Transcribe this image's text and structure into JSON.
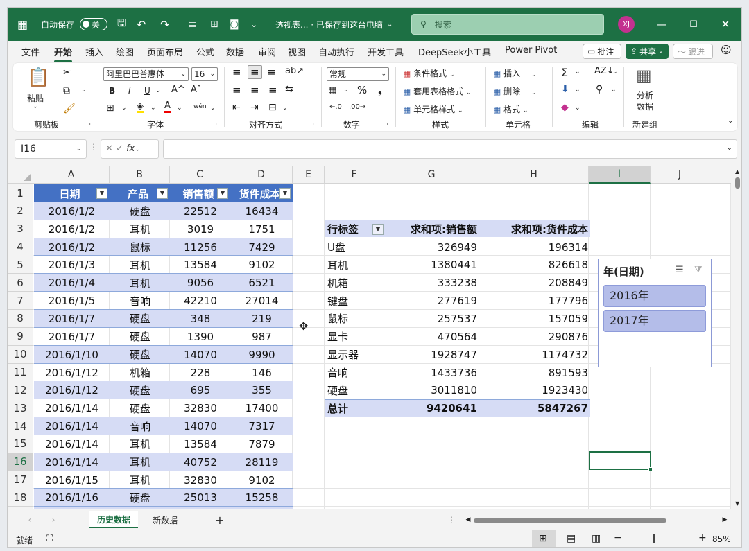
{
  "titlebar": {
    "autosave_label": "自动保存",
    "autosave_state": "关",
    "doc_title": "透视表... · 已保存到这台电脑",
    "search_placeholder": "搜索",
    "avatar": "XJ"
  },
  "menu_tabs": [
    "文件",
    "开始",
    "插入",
    "绘图",
    "页面布局",
    "公式",
    "数据",
    "审阅",
    "视图",
    "自动执行",
    "开发工具",
    "DeepSeek小工具",
    "Power Pivot"
  ],
  "menu_buttons": {
    "comment": "批注",
    "share": "共享",
    "catch_up": "跟进"
  },
  "ribbon": {
    "clipboard": {
      "paste": "粘贴",
      "group": "剪贴板"
    },
    "font": {
      "name": "阿里巴巴普惠体",
      "size": "16",
      "group": "字体",
      "bold": "B",
      "italic": "I",
      "underline": "U"
    },
    "alignment": {
      "group": "对齐方式"
    },
    "number": {
      "format": "常规",
      "group": "数字"
    },
    "styles": {
      "cond_format": "条件格式",
      "table_format": "套用表格格式",
      "cell_style": "单元格样式",
      "group": "样式"
    },
    "cells": {
      "insert": "插入",
      "delete": "删除",
      "format": "格式",
      "group": "单元格"
    },
    "editing": {
      "group": "编辑"
    },
    "analysis": {
      "label1": "分析",
      "label2": "数据",
      "group": "新建组"
    }
  },
  "formula_bar": {
    "name_box": "I16",
    "fx": "fx"
  },
  "columns": [
    "A",
    "B",
    "C",
    "D",
    "E",
    "F",
    "G",
    "H",
    "I",
    "J"
  ],
  "rows": [
    "1",
    "2",
    "3",
    "4",
    "5",
    "6",
    "7",
    "8",
    "9",
    "10",
    "11",
    "12",
    "13",
    "14",
    "15",
    "16",
    "17",
    "18"
  ],
  "table": {
    "headers": [
      "日期",
      "产品",
      "销售额",
      "货件成本"
    ],
    "rows": [
      [
        "2016/1/2",
        "硬盘",
        "22512",
        "16434"
      ],
      [
        "2016/1/2",
        "耳机",
        "3019",
        "1751"
      ],
      [
        "2016/1/2",
        "鼠标",
        "11256",
        "7429"
      ],
      [
        "2016/1/3",
        "耳机",
        "13584",
        "9102"
      ],
      [
        "2016/1/4",
        "耳机",
        "9056",
        "6521"
      ],
      [
        "2016/1/5",
        "音响",
        "42210",
        "27014"
      ],
      [
        "2016/1/7",
        "硬盘",
        "348",
        "219"
      ],
      [
        "2016/1/7",
        "硬盘",
        "1390",
        "987"
      ],
      [
        "2016/1/10",
        "硬盘",
        "14070",
        "9990"
      ],
      [
        "2016/1/12",
        "机箱",
        "228",
        "146"
      ],
      [
        "2016/1/12",
        "硬盘",
        "695",
        "355"
      ],
      [
        "2016/1/14",
        "硬盘",
        "32830",
        "17400"
      ],
      [
        "2016/1/14",
        "音响",
        "14070",
        "7317"
      ],
      [
        "2016/1/14",
        "耳机",
        "13584",
        "7879"
      ],
      [
        "2016/1/14",
        "耳机",
        "40752",
        "28119"
      ],
      [
        "2016/1/15",
        "耳机",
        "32830",
        "9102"
      ],
      [
        "2016/1/16",
        "硬盘",
        "25013",
        "15258"
      ]
    ]
  },
  "pivot": {
    "headers": [
      "行标签",
      "求和项:销售额",
      "求和项:货件成本"
    ],
    "rows": [
      [
        "U盘",
        "326949",
        "196314"
      ],
      [
        "耳机",
        "1380441",
        "826618"
      ],
      [
        "机箱",
        "333238",
        "208849"
      ],
      [
        "键盘",
        "277619",
        "177796"
      ],
      [
        "鼠标",
        "257537",
        "157059"
      ],
      [
        "显卡",
        "470564",
        "290876"
      ],
      [
        "显示器",
        "1928747",
        "1174732"
      ],
      [
        "音响",
        "1433736",
        "891593"
      ],
      [
        "硬盘",
        "3011810",
        "1923430"
      ]
    ],
    "total": [
      "总计",
      "9420641",
      "5847267"
    ]
  },
  "slicer": {
    "title": "年(日期)",
    "items": [
      "2016年",
      "2017年"
    ]
  },
  "sheets": [
    "历史数据",
    "新数据"
  ],
  "status": {
    "ready": "就绪",
    "zoom": "85%"
  }
}
